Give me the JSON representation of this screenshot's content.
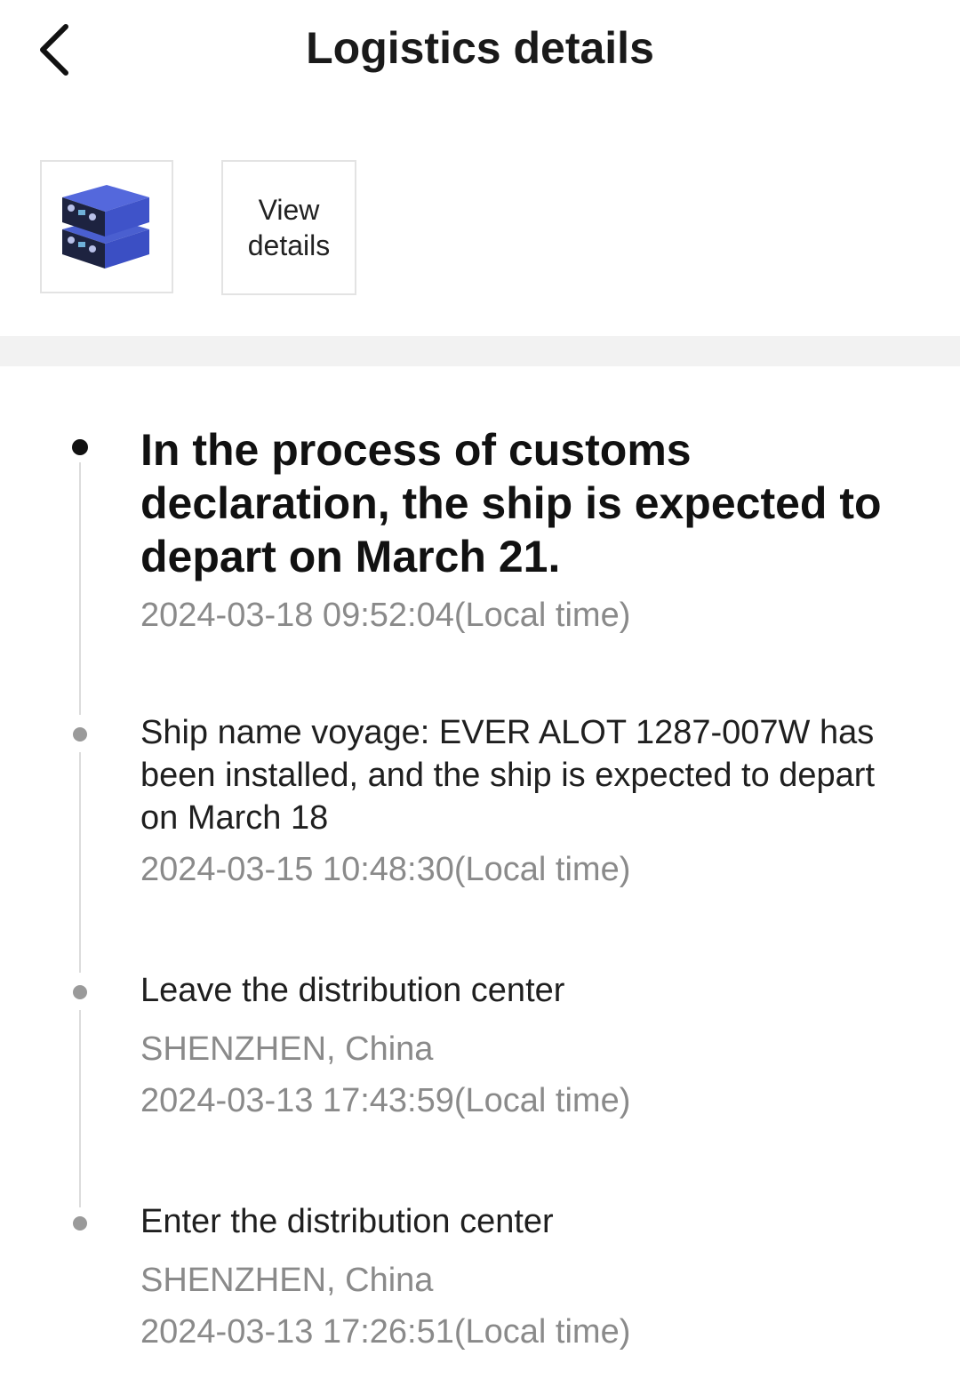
{
  "header": {
    "title": "Logistics details",
    "back_icon": "chevron-left-icon"
  },
  "product": {
    "thumbnail_icon": "battery-cells-icon",
    "view_details_label": "View details"
  },
  "timeline": {
    "events": [
      {
        "title": "In the process of customs declaration, the ship is expected to depart on March 21.",
        "location": "",
        "time": "2024-03-18 09:52:04(Local time)",
        "current": true
      },
      {
        "title": "Ship name voyage: EVER ALOT 1287-007W has been installed, and the ship is expected to depart on March 18",
        "location": "",
        "time": "2024-03-15 10:48:30(Local time)",
        "current": false
      },
      {
        "title": "Leave the distribution center",
        "location": "SHENZHEN, China",
        "time": "2024-03-13 17:43:59(Local time)",
        "current": false
      },
      {
        "title": "Enter the distribution center",
        "location": "SHENZHEN, China",
        "time": "2024-03-13 17:26:51(Local time)",
        "current": false
      }
    ]
  },
  "colors": {
    "accent_dot": "#111111",
    "inactive_dot": "#9a9a9a",
    "muted_text": "#8a8a8a",
    "divider": "#f2f2f2"
  }
}
